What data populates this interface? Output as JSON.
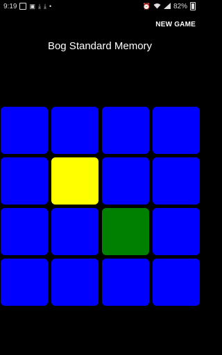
{
  "status_bar": {
    "time": "9:19",
    "battery": "82%",
    "left_icons": [
      "gallery-icon",
      "image-icon",
      "download-icon",
      "download-icon",
      "dot-icon"
    ],
    "right_icons": [
      "alarm-icon",
      "wifi-icon",
      "signal-icon"
    ]
  },
  "action_bar": {
    "new_game_label": "NEW GAME"
  },
  "title": "Bog Standard Memory",
  "colors": {
    "blue": "#0000ff",
    "yellow": "#ffff00",
    "green": "#008000",
    "background": "#000000"
  },
  "grid": {
    "rows": 4,
    "cols": 4,
    "tiles": [
      "blue",
      "blue",
      "blue",
      "blue",
      "blue",
      "yellow",
      "blue",
      "blue",
      "blue",
      "blue",
      "green",
      "blue",
      "blue",
      "blue",
      "blue",
      "blue"
    ]
  }
}
